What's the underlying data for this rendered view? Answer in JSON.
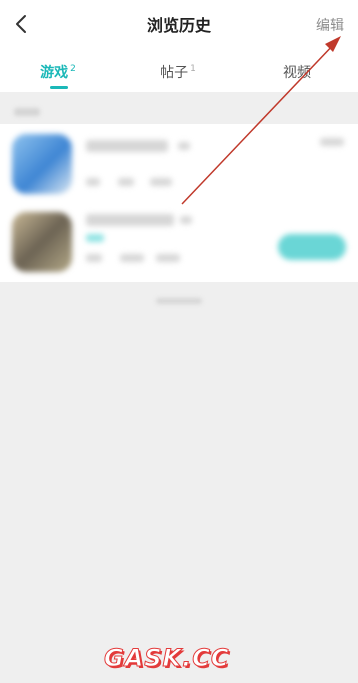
{
  "header": {
    "title": "浏览历史",
    "edit_label": "编辑"
  },
  "tabs": [
    {
      "label": "游戏",
      "count": "2"
    },
    {
      "label": "帖子",
      "count": "1"
    },
    {
      "label": "视频",
      "count": ""
    }
  ],
  "colors": {
    "accent": "#1bb8b8",
    "annotation_arrow": "#c0392b"
  },
  "icons": {
    "back": "chevron-left-icon"
  },
  "watermark": "GASK.CC"
}
